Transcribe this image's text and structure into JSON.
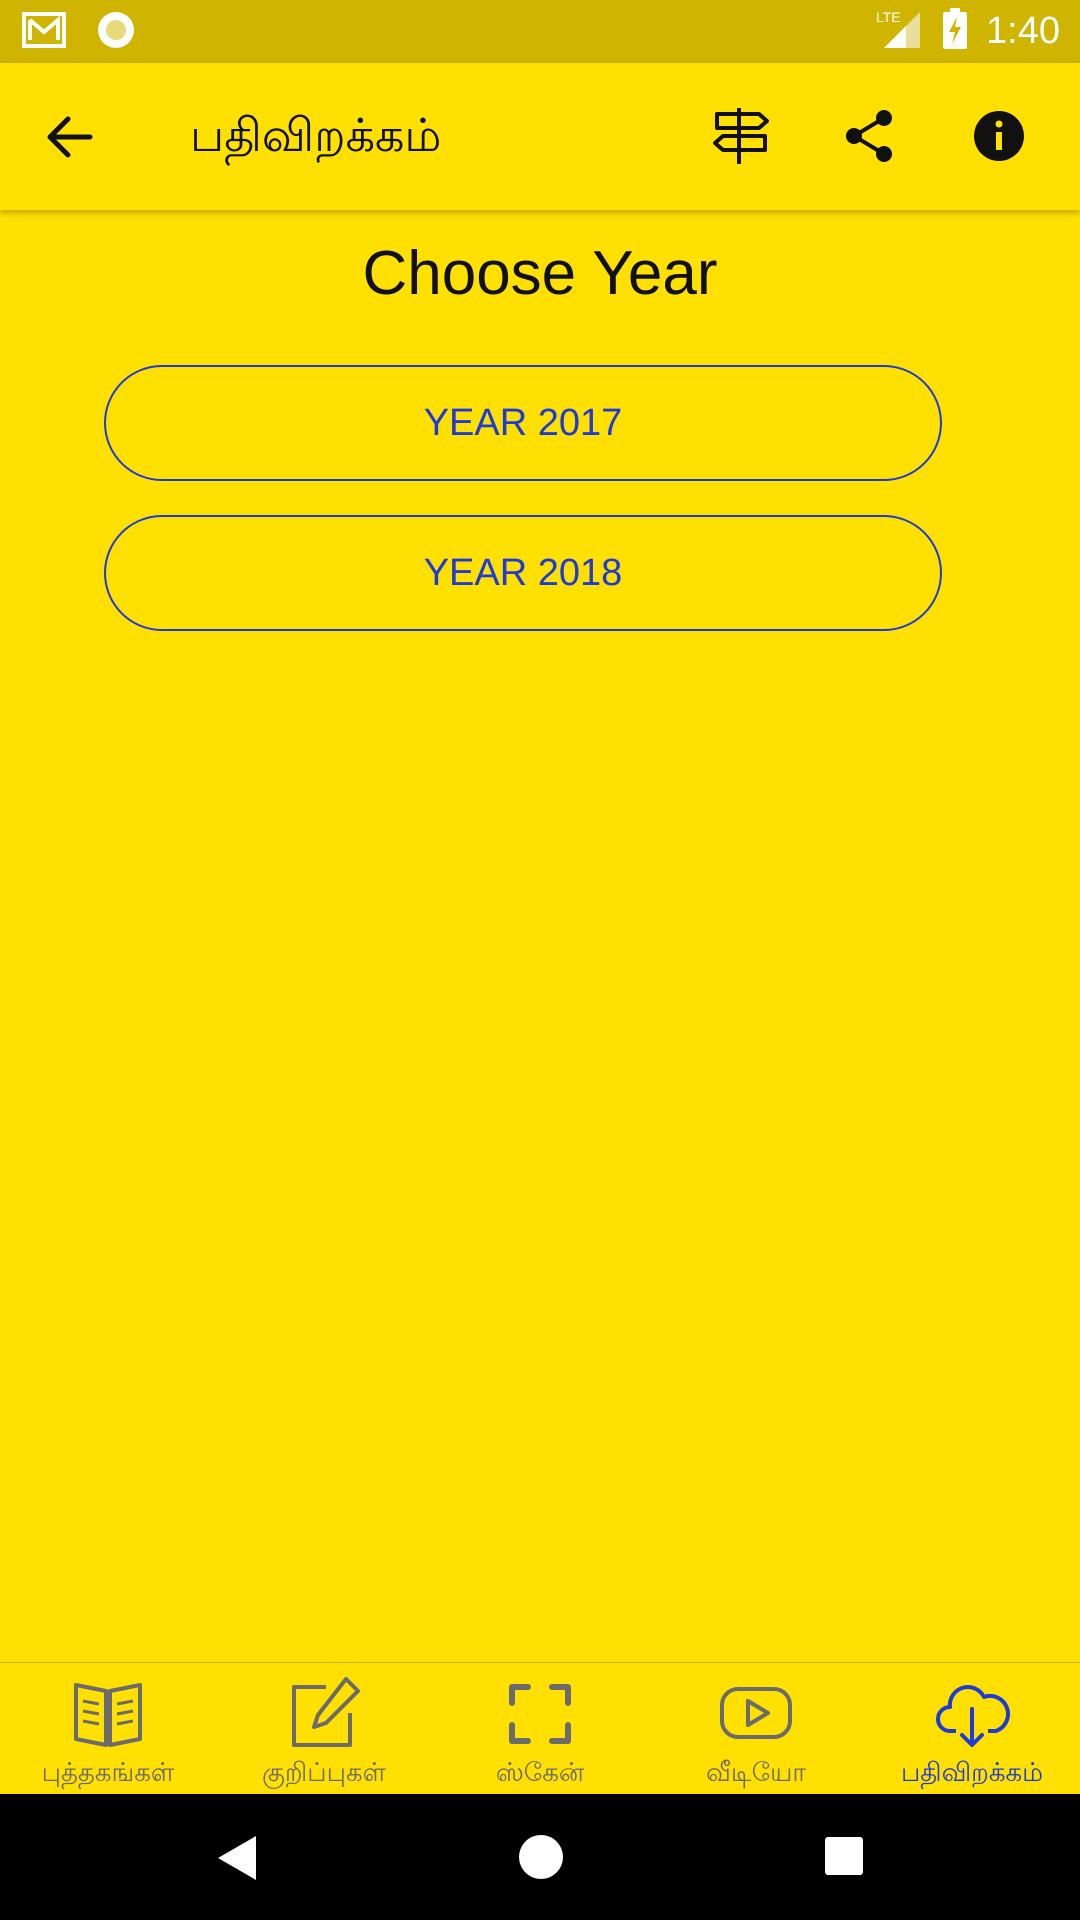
{
  "status_bar": {
    "network": "LTE",
    "time": "1:40",
    "icons": [
      "gmail-icon",
      "record-icon",
      "lte-signal-icon",
      "battery-charging-icon"
    ]
  },
  "app_bar": {
    "title": "பதிவிறக்கம்",
    "actions": [
      "signpost-icon",
      "share-icon",
      "info-icon"
    ]
  },
  "main": {
    "heading": "Choose Year",
    "years": [
      {
        "label": "YEAR 2017"
      },
      {
        "label": "YEAR 2018"
      }
    ]
  },
  "bottom_nav": {
    "items": [
      {
        "label": "புத்தகங்கள்",
        "icon": "book-icon",
        "active": false
      },
      {
        "label": "குறிப்புகள்",
        "icon": "edit-note-icon",
        "active": false
      },
      {
        "label": "ஸ்கேன்",
        "icon": "scan-icon",
        "active": false
      },
      {
        "label": "வீடியோ",
        "icon": "video-play-icon",
        "active": false
      },
      {
        "label": "பதிவிறக்கம்",
        "icon": "cloud-download-icon",
        "active": true
      }
    ]
  },
  "colors": {
    "background": "#FFE000",
    "status_bar": "#CFB400",
    "accent": "#1F3BD6",
    "inactive": "#6B6B6B"
  }
}
